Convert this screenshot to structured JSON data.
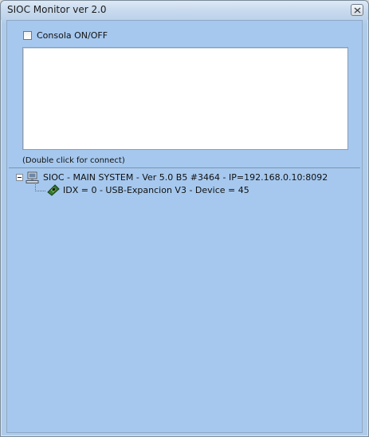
{
  "window": {
    "title": "SIOC Monitor ver 2.0"
  },
  "console": {
    "checkbox_label": "Consola ON/OFF",
    "checked": false,
    "output_text": ""
  },
  "hint": {
    "text": "(Double click for connect)"
  },
  "tree": {
    "root": {
      "label": "SIOC - MAIN SYSTEM - Ver 5.0 B5 #3464 - IP=192.168.0.10:8092",
      "icon": "computer-icon",
      "expanded": true
    },
    "children": [
      {
        "label": "IDX = 0 - USB-Expancion V3 - Device = 45",
        "icon": "circuit-board-icon"
      }
    ]
  },
  "colors": {
    "client_background": "#a6c8ee",
    "titlebar": "#c8daee",
    "console_background": "#ffffff"
  }
}
